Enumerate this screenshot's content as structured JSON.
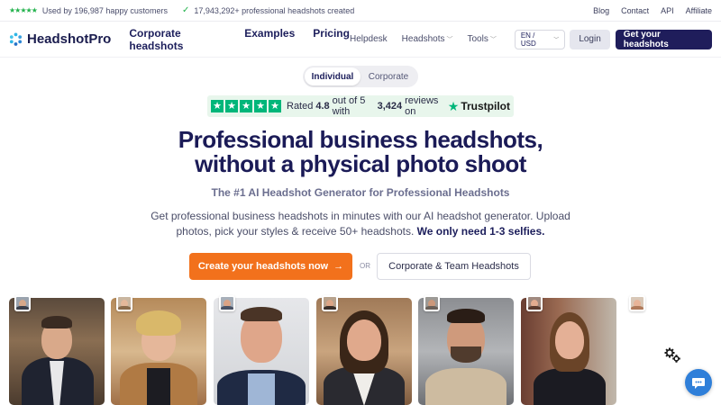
{
  "topbar": {
    "stars": "★★★★★",
    "customers": "Used by 196,987 happy customers",
    "headshots": "17,943,292+ professional headshots created",
    "links": [
      "Blog",
      "Contact",
      "API",
      "Affiliate"
    ]
  },
  "nav": {
    "logo": "HeadshotPro",
    "main_links": [
      "Corporate headshots",
      "Examples",
      "Pricing"
    ],
    "helpdesk": "Helpdesk",
    "headshots_menu": "Headshots",
    "tools_menu": "Tools",
    "language": "EN / USD",
    "login": "Login",
    "cta": "Get your headshots"
  },
  "toggle": {
    "options": [
      "Individual",
      "Corporate"
    ],
    "selected": "Individual"
  },
  "trustpilot": {
    "rated": "Rated",
    "score": "4.8",
    "out_of": "out of 5 with",
    "count": "3,424",
    "reviews_on": "reviews on",
    "brand": "Trustpilot",
    "brand_color": "#00b67a"
  },
  "hero": {
    "title_line1": "Professional business headshots,",
    "title_line2": "without a physical photo shoot",
    "subtitle": "The #1 AI Headshot Generator for Professional Headshots",
    "desc_line1": "Get professional business headshots in minutes with our AI headshot generator. Upload",
    "desc_line2": "photos, pick your styles & receive 50+ headshots.",
    "desc_bold": "We only need 1-3 selfies."
  },
  "cta": {
    "primary": "Create your headshots now",
    "primary_arrow": "→",
    "or": "OR",
    "secondary": "Corporate & Team Headshots",
    "primary_color": "#f2711c"
  },
  "colors": {
    "navy": "#1b1b57",
    "accent": "#f2711c",
    "chat": "#2f7fd9"
  }
}
